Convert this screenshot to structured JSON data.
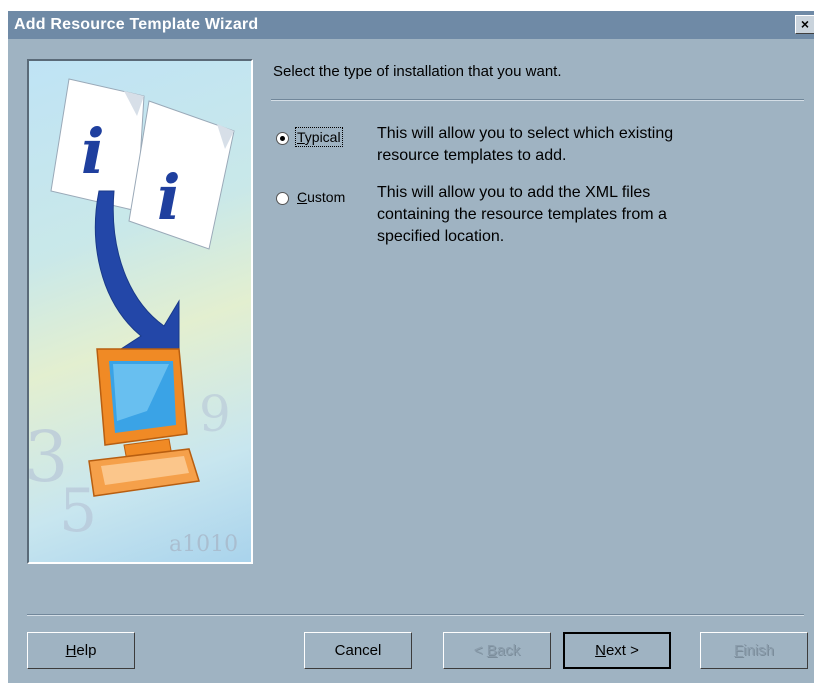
{
  "window": {
    "title": "Add Resource Template Wizard",
    "close_label": "×"
  },
  "prompt": "Select the type of installation that you want.",
  "options": [
    {
      "accel": "T",
      "rest": "ypical",
      "selected": true,
      "description_lines": [
        "This will allow you to select which existing",
        "resource templates to add."
      ]
    },
    {
      "accel": "C",
      "rest": "ustom",
      "selected": false,
      "description_lines": [
        "This will allow you to add the XML files",
        "containing the resource templates from a",
        "specified location."
      ]
    }
  ],
  "buttons": {
    "help": {
      "accel": "H",
      "rest": "elp"
    },
    "cancel": {
      "label": "Cancel"
    },
    "back": {
      "pre": "< ",
      "accel": "B",
      "rest": "ack",
      "enabled": false
    },
    "next": {
      "accel": "N",
      "rest": "ext >",
      "enabled": true
    },
    "finish": {
      "accel": "F",
      "rest": "inish",
      "enabled": false
    }
  },
  "illustration": {
    "page_letter": "i"
  },
  "colors": {
    "dialog_bg": "#9fb3c2",
    "titlebar_bg": "#6f8aa6"
  }
}
